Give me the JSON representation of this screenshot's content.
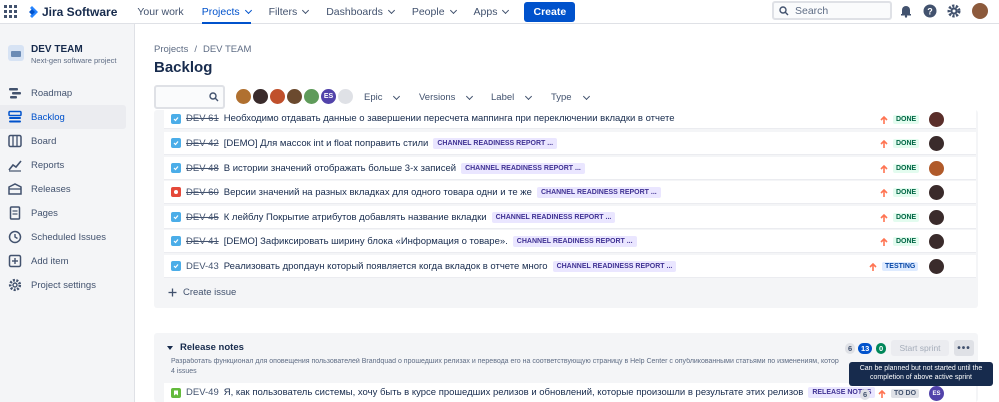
{
  "topnav": {
    "logo": "Jira Software",
    "items": [
      "Your work",
      "Projects",
      "Filters",
      "Dashboards",
      "People",
      "Apps"
    ],
    "create": "Create",
    "search_placeholder": "Search"
  },
  "sidebar": {
    "project_name": "DEV TEAM",
    "project_type": "Next-gen software project",
    "items": [
      {
        "label": "Roadmap",
        "icon": "roadmap-icon"
      },
      {
        "label": "Backlog",
        "icon": "backlog-icon"
      },
      {
        "label": "Board",
        "icon": "board-icon"
      },
      {
        "label": "Reports",
        "icon": "reports-icon"
      },
      {
        "label": "Releases",
        "icon": "releases-icon"
      },
      {
        "label": "Pages",
        "icon": "pages-icon"
      },
      {
        "label": "Scheduled Issues",
        "icon": "scheduled-icon"
      },
      {
        "label": "Add item",
        "icon": "add-item-icon"
      },
      {
        "label": "Project settings",
        "icon": "settings-icon"
      }
    ]
  },
  "main": {
    "breadcrumb": [
      "Projects",
      "/",
      "DEV TEAM"
    ],
    "title": "Backlog",
    "filters": [
      "Epic",
      "Versions",
      "Label",
      "Type"
    ],
    "avatar_initials": "ES"
  },
  "issues": [
    {
      "type": "task",
      "key": "DEV-61",
      "summary": "Необходимо отдавать данные о завершении пересчета маппинга при переключении вкладки в отчете",
      "epic": "",
      "status": "DONE"
    },
    {
      "type": "task",
      "key": "DEV-42",
      "summary": "[DEMO] Для массок int и float поправить стили",
      "epic": "CHANNEL READINESS REPORT ...",
      "status": "DONE"
    },
    {
      "type": "task",
      "key": "DEV-48",
      "summary": "В истории значений отображать больше 3-х записей",
      "epic": "CHANNEL READINESS REPORT ...",
      "status": "DONE"
    },
    {
      "type": "bug",
      "key": "DEV-60",
      "summary": "Версии значений на разных вкладках для одного товара одни и те же",
      "epic": "CHANNEL READINESS REPORT ...",
      "status": "DONE"
    },
    {
      "type": "task",
      "key": "DEV-45",
      "summary": "К лейблу Покрытие атрибутов добавлять название вкладки",
      "epic": "CHANNEL READINESS REPORT ...",
      "status": "DONE"
    },
    {
      "type": "task",
      "key": "DEV-41",
      "summary": "[DEMO] Зафиксировать ширину блока «Информация о товаре».",
      "epic": "CHANNEL READINESS REPORT ...",
      "status": "DONE"
    },
    {
      "type": "task",
      "key": "DEV-43",
      "summary": "Реализовать дропдаун который появляется когда вкладок в отчете много",
      "epic": "CHANNEL READINESS REPORT ...",
      "status": "TESTING"
    }
  ],
  "create_issue": "Create issue",
  "sprint": {
    "name": "Release notes",
    "description": "Разработать функционал для оповещения пользователей Brandquad о прошедших релизах и перевода его на соответствующую страницу в Help Center с опубликованными статьями по изменениям, котор",
    "count": "4 issues",
    "counts": [
      "6",
      "13",
      "0"
    ],
    "start": "Start sprint",
    "more": "•••",
    "tooltip": "Can be planned but not started until the completion of above active sprint",
    "issue": {
      "key": "DEV-49",
      "summary": "Я, как пользователь системы, хочу быть в курсе прошедших релизов и обновлений, которые произошли в результате этих релизов",
      "epic": "RELEASE NOTES",
      "status": "TO DO",
      "points": "6",
      "avatar": "ES"
    }
  },
  "colors": {
    "accent": "#0052CC",
    "done": "#006644",
    "bug": "#E5493A",
    "task": "#4BADE8",
    "story": "#63BA3C"
  }
}
